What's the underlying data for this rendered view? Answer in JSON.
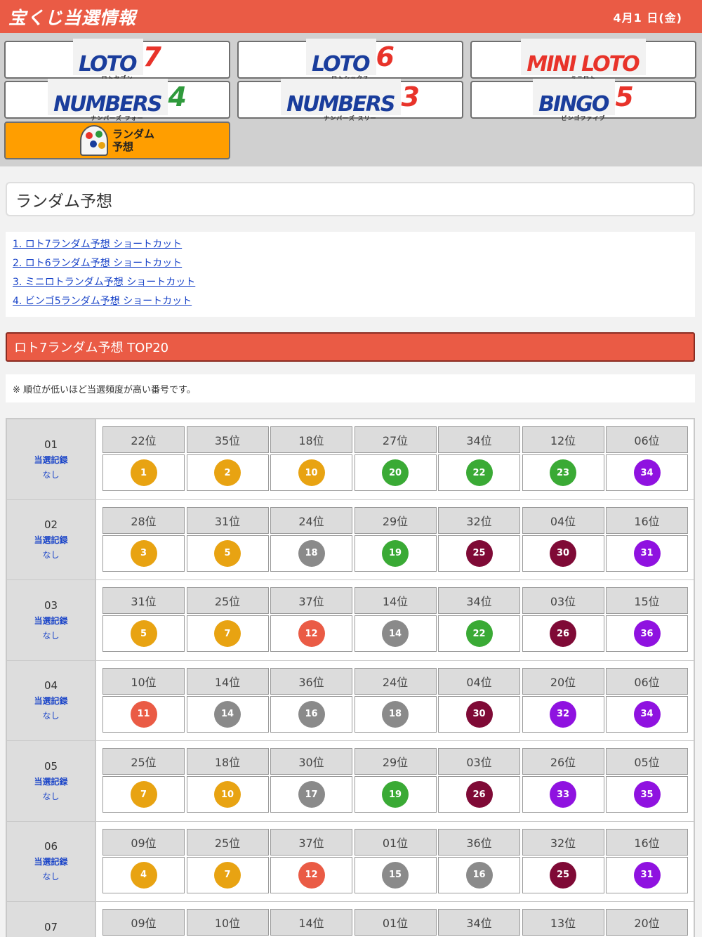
{
  "header": {
    "title": "宝くじ当選情報",
    "date": "4月1 日(金)"
  },
  "nav": [
    {
      "id": "loto7",
      "main": "LOTO",
      "num": "7",
      "sub": "ロトセブン",
      "color": "#1a3d9c",
      "num_color": "#e8332a"
    },
    {
      "id": "loto6",
      "main": "LOTO",
      "num": "6",
      "sub": "ロトシックス",
      "color": "#1a3d9c",
      "num_color": "#e8332a"
    },
    {
      "id": "miniloto",
      "main": "MINI LOTO",
      "num": "",
      "sub": "ミニロト",
      "color": "#e8332a",
      "num_color": "#e8332a"
    },
    {
      "id": "numbers4",
      "main": "NUMBERS",
      "num": "4",
      "sub": "ナンバーズ フォー",
      "color": "#1a3d9c",
      "num_color": "#2f9a3c"
    },
    {
      "id": "numbers3",
      "main": "NUMBERS",
      "num": "3",
      "sub": "ナンバーズ スリー",
      "color": "#1a3d9c",
      "num_color": "#e8332a"
    },
    {
      "id": "bingo5",
      "main": "BINGO",
      "num": "5",
      "sub": "ビンゴファイブ",
      "color": "#1a3d9c",
      "num_color": "#e8332a"
    },
    {
      "id": "random",
      "line1": "ランダム",
      "line2": "予想"
    }
  ],
  "page_title": "ランダム予想",
  "links": [
    "1. ロト7ランダム予想 ショートカット",
    "2. ロト6ランダム予想 ショートカット",
    "3. ミニロトランダム予想 ショートカット",
    "4. ビンゴ5ランダム予想 ショートカット"
  ],
  "section_title": "ロト7ランダム予想 TOP20",
  "note": "※ 順位が低いほど当選頻度が高い番号です。",
  "record_label": "当選記録",
  "record_value": "なし",
  "ball_colors": {
    "yellow": "#e8a312",
    "green": "#3aaa35",
    "purple": "#8f12e0",
    "gray": "#8a8a8a",
    "maroon": "#7f0a36",
    "red": "#ea5b45"
  },
  "rows": [
    {
      "no": "01",
      "ranks": [
        "22位",
        "35位",
        "18位",
        "27位",
        "34位",
        "12位",
        "06位"
      ],
      "balls": [
        [
          "1",
          "yellow"
        ],
        [
          "2",
          "yellow"
        ],
        [
          "10",
          "yellow"
        ],
        [
          "20",
          "green"
        ],
        [
          "22",
          "green"
        ],
        [
          "23",
          "green"
        ],
        [
          "34",
          "purple"
        ]
      ]
    },
    {
      "no": "02",
      "ranks": [
        "28位",
        "31位",
        "24位",
        "29位",
        "32位",
        "04位",
        "16位"
      ],
      "balls": [
        [
          "3",
          "yellow"
        ],
        [
          "5",
          "yellow"
        ],
        [
          "18",
          "gray"
        ],
        [
          "19",
          "green"
        ],
        [
          "25",
          "maroon"
        ],
        [
          "30",
          "maroon"
        ],
        [
          "31",
          "purple"
        ]
      ]
    },
    {
      "no": "03",
      "ranks": [
        "31位",
        "25位",
        "37位",
        "14位",
        "34位",
        "03位",
        "15位"
      ],
      "balls": [
        [
          "5",
          "yellow"
        ],
        [
          "7",
          "yellow"
        ],
        [
          "12",
          "red"
        ],
        [
          "14",
          "gray"
        ],
        [
          "22",
          "green"
        ],
        [
          "26",
          "maroon"
        ],
        [
          "36",
          "purple"
        ]
      ]
    },
    {
      "no": "04",
      "ranks": [
        "10位",
        "14位",
        "36位",
        "24位",
        "04位",
        "20位",
        "06位"
      ],
      "balls": [
        [
          "11",
          "red"
        ],
        [
          "14",
          "gray"
        ],
        [
          "16",
          "gray"
        ],
        [
          "18",
          "gray"
        ],
        [
          "30",
          "maroon"
        ],
        [
          "32",
          "purple"
        ],
        [
          "34",
          "purple"
        ]
      ]
    },
    {
      "no": "05",
      "ranks": [
        "25位",
        "18位",
        "30位",
        "29位",
        "03位",
        "26位",
        "05位"
      ],
      "balls": [
        [
          "7",
          "yellow"
        ],
        [
          "10",
          "yellow"
        ],
        [
          "17",
          "gray"
        ],
        [
          "19",
          "green"
        ],
        [
          "26",
          "maroon"
        ],
        [
          "33",
          "purple"
        ],
        [
          "35",
          "purple"
        ]
      ]
    },
    {
      "no": "06",
      "ranks": [
        "09位",
        "25位",
        "37位",
        "01位",
        "36位",
        "32位",
        "16位"
      ],
      "balls": [
        [
          "4",
          "yellow"
        ],
        [
          "7",
          "yellow"
        ],
        [
          "12",
          "red"
        ],
        [
          "15",
          "gray"
        ],
        [
          "16",
          "gray"
        ],
        [
          "25",
          "maroon"
        ],
        [
          "31",
          "purple"
        ]
      ]
    },
    {
      "no": "07",
      "ranks": [
        "09位",
        "10位",
        "14位",
        "01位",
        "34位",
        "13位",
        "20位"
      ],
      "balls": []
    }
  ]
}
